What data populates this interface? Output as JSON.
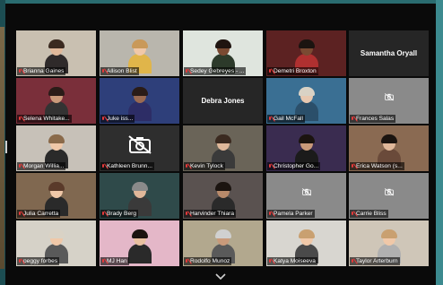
{
  "participants": [
    {
      "name": "Brianna Gaines",
      "muted": true,
      "video": "on",
      "bg": "#c9c0b1",
      "skin": "#e0b89a",
      "hair": "#3b2a20",
      "shirt": "#2f2a2a"
    },
    {
      "name": "Allison Blist",
      "muted": true,
      "video": "on",
      "bg": "#b9b6ad",
      "skin": "#f0c8a8",
      "hair": "#c9995a",
      "shirt": "#e0b54a"
    },
    {
      "name": "Sedey Gebreyes - ...",
      "muted": true,
      "video": "on",
      "bg": "#dfe5de",
      "skin": "#7a4a32",
      "hair": "#1f1410",
      "shirt": "#2c3a2a",
      "speaker": true
    },
    {
      "name": "Demetri Broxton",
      "muted": true,
      "video": "on",
      "bg": "#5c2222",
      "skin": "#7a4a32",
      "hair": "#1b1410",
      "shirt": "#b03030"
    },
    {
      "name": "Samantha Oryall",
      "muted": false,
      "video": "name",
      "bg": "#262626"
    },
    {
      "name": "Selena Whitake...",
      "muted": true,
      "video": "on",
      "bg": "#7a2f3a",
      "skin": "#c99a7a",
      "hair": "#2a1c18",
      "shirt": "#333"
    },
    {
      "name": "Juke iss...",
      "muted": true,
      "video": "on",
      "bg": "#2e3f7a",
      "skin": "#9a6a52",
      "hair": "#2a1c18",
      "shirt": "#2d2d66"
    },
    {
      "name": "Debra Jones",
      "muted": false,
      "video": "name",
      "bg": "#262626"
    },
    {
      "name": "Gail McFall",
      "muted": true,
      "video": "on",
      "bg": "#3a6f93",
      "skin": "#e8c8b0",
      "hair": "#d9d2c5",
      "shirt": "#2b4f6a"
    },
    {
      "name": "Frances Salas",
      "muted": true,
      "video": "off",
      "bg": "#8a8a8a"
    },
    {
      "name": "Morgan Willia...",
      "muted": true,
      "video": "on",
      "bg": "#c7c1b8",
      "skin": "#f0c8a8",
      "hair": "#8a6a4a",
      "shirt": "#2a2a2a"
    },
    {
      "name": "Kathleen Brunn...",
      "muted": true,
      "video": "off",
      "bg": "#2e2e2e"
    },
    {
      "name": "Kevin Tylock",
      "muted": true,
      "video": "on",
      "bg": "#6a6458",
      "skin": "#e0b89a",
      "hair": "#3b2a20",
      "shirt": "#3a3a3a"
    },
    {
      "name": "Christopher Go...",
      "muted": true,
      "video": "on",
      "bg": "#3a2c50",
      "skin": "#c99a7a",
      "hair": "#1b1410",
      "shirt": "#1b1b1b"
    },
    {
      "name": "Erica Watson (s...",
      "muted": true,
      "video": "on",
      "bg": "#8a6a52",
      "skin": "#e0b89a",
      "hair": "#1b1410",
      "shirt": "#6a4a3a"
    },
    {
      "name": "Julia Carretta",
      "muted": true,
      "video": "on",
      "bg": "#806850",
      "skin": "#f0c8a8",
      "hair": "#5a3a2a",
      "shirt": "#2a2a2a"
    },
    {
      "name": "Brady Berg",
      "muted": true,
      "video": "on",
      "bg": "#2f4a4a",
      "skin": "#e0b89a",
      "hair": "#8a8a8a",
      "shirt": "#3a3a3a"
    },
    {
      "name": "Harvinder Thiara",
      "muted": true,
      "video": "on",
      "bg": "#5a5250",
      "skin": "#b88a6a",
      "hair": "#1b1410",
      "shirt": "#2a2a2a"
    },
    {
      "name": "Pamela Parker",
      "muted": true,
      "video": "off",
      "bg": "#8a8a8a"
    },
    {
      "name": "Carrie Bliss",
      "muted": true,
      "video": "off",
      "bg": "#8a8a8a"
    },
    {
      "name": "peggy forbes",
      "muted": true,
      "video": "on",
      "bg": "#d6d2c8",
      "skin": "#f0c8a8",
      "hair": "#d9d2c5",
      "shirt": "#5a5a5a"
    },
    {
      "name": "MJ Han",
      "muted": true,
      "video": "on",
      "bg": "#e4b7c8",
      "skin": "#e8c0a0",
      "hair": "#1b1410",
      "shirt": "#2a2a2a"
    },
    {
      "name": "Rodolfo Munoz",
      "muted": true,
      "video": "on",
      "bg": "#b2a88e",
      "skin": "#c99a7a",
      "hair": "#d0d0d0",
      "shirt": "#5a5a5a"
    },
    {
      "name": "Katya Moiseeva",
      "muted": true,
      "video": "on",
      "bg": "#d8d6d0",
      "skin": "#f0c8a8",
      "hair": "#c9a070",
      "shirt": "#4a4a4a"
    },
    {
      "name": "Taylor Arterburn",
      "muted": true,
      "video": "on",
      "bg": "#cfc6b8",
      "skin": "#f0c8a8",
      "hair": "#c9a070",
      "shirt": "#b0b0b0"
    }
  ],
  "colors": {
    "speaker_highlight": "#d8e23a",
    "mute_red": "#e5393a",
    "tile_bg": "#262626"
  }
}
